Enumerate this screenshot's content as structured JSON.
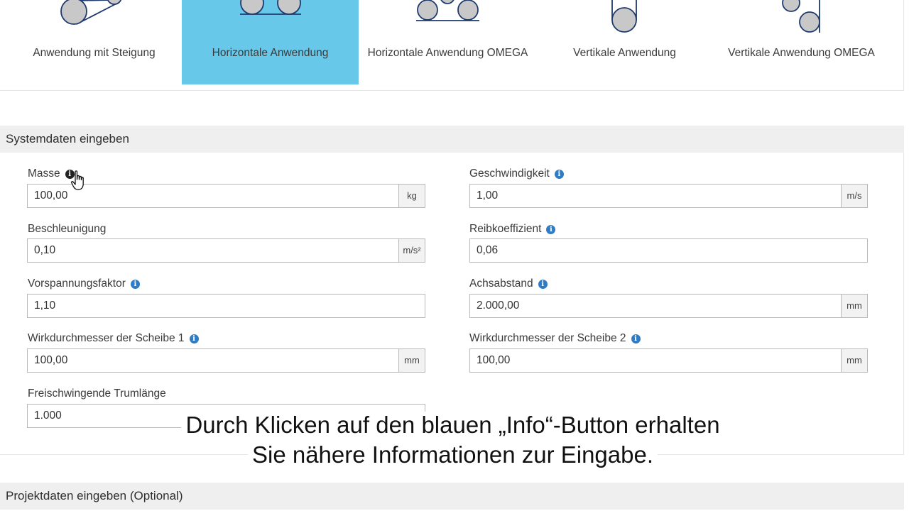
{
  "applications": [
    {
      "label": "Anwendung mit Steigung",
      "active": false
    },
    {
      "label": "Horizontale Anwendung",
      "active": true
    },
    {
      "label": "Horizontale Anwendung OMEGA",
      "active": false
    },
    {
      "label": "Vertikale Anwendung",
      "active": false
    },
    {
      "label": "Vertikale Anwendung OMEGA",
      "active": false
    }
  ],
  "system_section": {
    "title": "Systemdaten eingeben",
    "fields": {
      "masse": {
        "label": "Masse",
        "value": "100,00",
        "unit": "kg"
      },
      "geschwindigkeit": {
        "label": "Geschwindigkeit",
        "value": "1,00",
        "unit": "m/s"
      },
      "beschleunigung": {
        "label": "Beschleunigung",
        "value": "0,10",
        "unit": "m/s²"
      },
      "reibkoeffizient": {
        "label": "Reibkoeffizient",
        "value": "0,06"
      },
      "vorspannungsfaktor": {
        "label": "Vorspannungsfaktor",
        "value": "1,10"
      },
      "achsabstand": {
        "label": "Achsabstand",
        "value": "2.000,00",
        "unit": "mm"
      },
      "scheibe1": {
        "label": "Wirkdurchmesser der Scheibe 1",
        "value": "100,00",
        "unit": "mm"
      },
      "scheibe2": {
        "label": "Wirkdurchmesser der Scheibe 2",
        "value": "100,00",
        "unit": "mm"
      },
      "trumlaenge": {
        "label": "Freischwingende Trumlänge",
        "value": "1.000"
      }
    }
  },
  "project_section": {
    "title": "Projektdaten eingeben (Optional)"
  },
  "caption": {
    "line1": "Durch Klicken auf den blauen „Info“-Button erhalten",
    "line2": "Sie nähere Informationen zur Eingabe."
  },
  "colors": {
    "active_tab": "#67c8ea",
    "info_icon": "#2f7bc4",
    "pulley_stroke": "#1e3a6e",
    "pulley_fill": "#c8c8c8"
  },
  "icons": {
    "info": "info-circle-icon",
    "cursor": "hand-pointer-icon"
  }
}
